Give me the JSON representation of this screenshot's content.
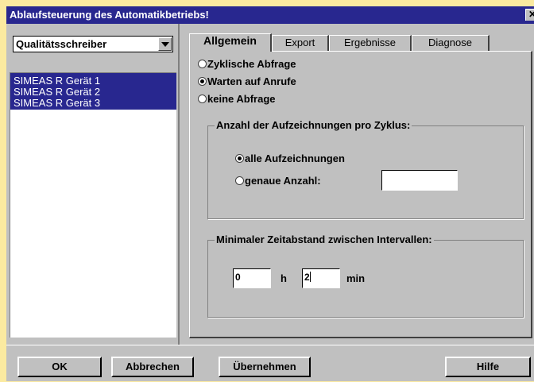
{
  "window": {
    "title": "Ablaufsteuerung des Automatikbetriebs!",
    "close_glyph": "✕"
  },
  "sidebar": {
    "combo_value": "Qualitätsschreiber",
    "devices": [
      "SIMEAS R  Gerät 1",
      "SIMEAS R  Gerät 2",
      "SIMEAS R  Gerät 3"
    ]
  },
  "tabs": [
    "Allgemein",
    "Export",
    "Ergebnisse",
    "Diagnose"
  ],
  "active_tab": "Allgemein",
  "general": {
    "query_options": [
      {
        "label": "Zyklische Abfrage",
        "selected": false
      },
      {
        "label": "Warten auf Anrufe",
        "selected": true
      },
      {
        "label": "keine Abfrage",
        "selected": false
      }
    ],
    "records_group": {
      "legend": "Anzahl der Aufzeichnungen pro Zyklus:",
      "options": [
        {
          "label": "alle Aufzeichnungen",
          "selected": true
        },
        {
          "label": "genaue Anzahl:",
          "selected": false
        }
      ],
      "exact_count_value": ""
    },
    "interval_group": {
      "legend": "Minimaler Zeitabstand zwischen Intervallen:",
      "hours_value": "0",
      "hours_unit": "h",
      "minutes_value": "2",
      "minutes_unit": "min"
    }
  },
  "buttons": {
    "ok": "OK",
    "cancel": "Abbrechen",
    "apply": "Übernehmen",
    "help": "Hilfe"
  },
  "colors": {
    "titlebar": "#28278f",
    "selection": "#28278f",
    "background": "#fbeaa0",
    "face": "#c0c0c0"
  }
}
